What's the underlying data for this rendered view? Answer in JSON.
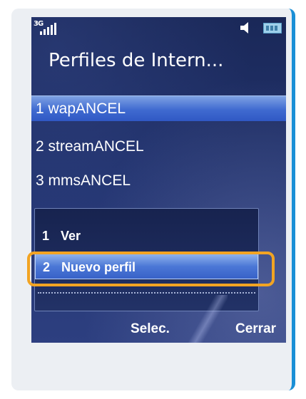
{
  "status": {
    "network_label": "3G",
    "signal_icon": "signal-bars-icon",
    "sound_icon": "speaker-icon",
    "battery_icon": "battery-icon"
  },
  "header": {
    "title": "Perfiles de Intern..."
  },
  "profiles": [
    {
      "label": "1 wapANCEL",
      "selected": true
    },
    {
      "label": "2 streamANCEL",
      "selected": false
    },
    {
      "label": "3 mmsANCEL",
      "selected": false
    }
  ],
  "options_menu": {
    "items": [
      {
        "num": "1",
        "label": "Ver",
        "selected": false
      },
      {
        "num": "2",
        "label": "Nuevo perfil",
        "selected": true
      }
    ]
  },
  "softkeys": {
    "left": "Selec.",
    "right": "Cerrar"
  },
  "colors": {
    "highlight_ring": "#f2a423",
    "selection": "#3f6ad0",
    "background": "#1d2d63"
  }
}
